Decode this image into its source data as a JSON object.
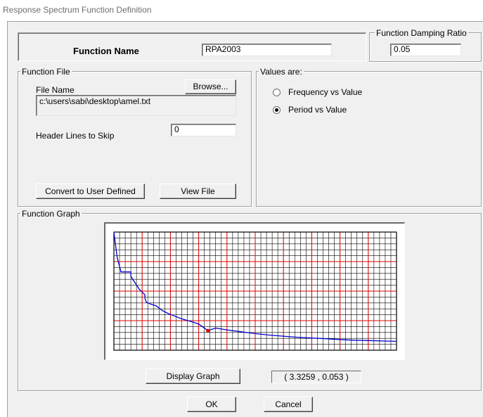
{
  "window": {
    "title": "Response Spectrum  Function Definition"
  },
  "function_name": {
    "label": "Function Name",
    "value": "RPA2003"
  },
  "damping": {
    "label": "Function Damping Ratio",
    "value": "0.05"
  },
  "function_file": {
    "group_label": "Function File",
    "file_name_label": "File Name",
    "browse_label": "Browse...",
    "path": "c:\\users\\sabi\\desktop\\amel.txt",
    "header_lines_label": "Header Lines to Skip",
    "header_lines_value": "0",
    "convert_label": "Convert to User Defined",
    "view_file_label": "View File"
  },
  "values_are": {
    "group_label": "Values are:",
    "options": [
      {
        "label": "Frequency vs Value",
        "checked": false
      },
      {
        "label": "Period vs Value",
        "checked": true
      }
    ]
  },
  "function_graph": {
    "group_label": "Function Graph",
    "display_graph_label": "Display Graph",
    "coordinate_readout": "( 3.3259  ,  0.053 )"
  },
  "buttons": {
    "ok_label": "OK",
    "cancel_label": "Cancel"
  },
  "colors": {
    "curve": "#0000cc",
    "major_grid": "#e00000",
    "minor_grid": "#000000",
    "marker": "#e00000"
  },
  "chart_data": {
    "type": "line",
    "title": "",
    "xlabel": "",
    "ylabel": "",
    "xlim": [
      0,
      10
    ],
    "ylim": [
      0,
      0.32
    ],
    "grid": true,
    "series": [
      {
        "x": [
          0.0,
          0.05,
          0.12,
          0.25,
          0.5,
          0.6,
          0.6,
          0.9,
          1.1,
          1.1,
          1.15,
          1.3,
          1.5,
          1.7,
          1.9,
          2.1,
          2.4,
          2.8,
          3.0,
          3.3259,
          3.6,
          4.0,
          4.5,
          5.0,
          5.5,
          6.0,
          6.5,
          7.0,
          7.5,
          8.0,
          8.5,
          9.0,
          9.5,
          10.0
        ],
        "y": [
          0.32,
          0.29,
          0.25,
          0.212,
          0.212,
          0.212,
          0.2,
          0.165,
          0.15,
          0.14,
          0.13,
          0.125,
          0.12,
          0.108,
          0.1,
          0.094,
          0.085,
          0.076,
          0.071,
          0.053,
          0.06,
          0.055,
          0.05,
          0.045,
          0.041,
          0.038,
          0.035,
          0.033,
          0.031,
          0.029,
          0.027,
          0.026,
          0.025,
          0.024
        ]
      }
    ],
    "marker": {
      "x": 3.3259,
      "y": 0.053
    }
  }
}
